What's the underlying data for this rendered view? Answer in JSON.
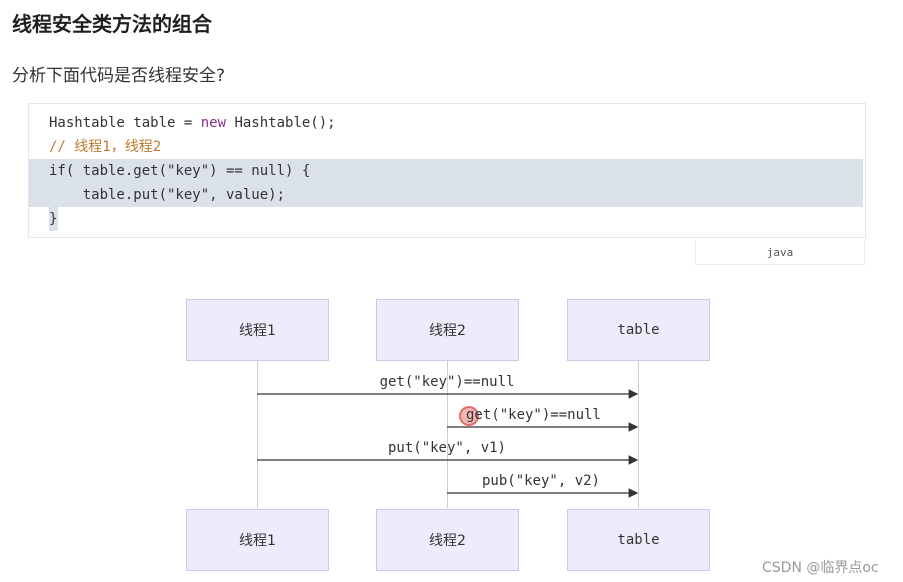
{
  "heading": "线程安全类方法的组合",
  "question": "分析下面代码是否线程安全?",
  "code": {
    "line1": {
      "a": "Hashtable table = ",
      "kw": "new",
      "b": " Hashtable();"
    },
    "line2": "// 线程1，线程2",
    "line3": "if( table.get(\"key\") == null) {",
    "line4": "    table.put(\"key\", value);",
    "line5": "}",
    "language": "java"
  },
  "diagram": {
    "participants_top": [
      "线程1",
      "线程2",
      "table"
    ],
    "participants_bottom": [
      "线程1",
      "线程2",
      "table"
    ],
    "messages": [
      "get(\"key\")==null",
      "get(\"key\")==null",
      "put(\"key\", v1)",
      "pub(\"key\", v2)"
    ]
  },
  "watermark": "CSDN @临界点oc"
}
